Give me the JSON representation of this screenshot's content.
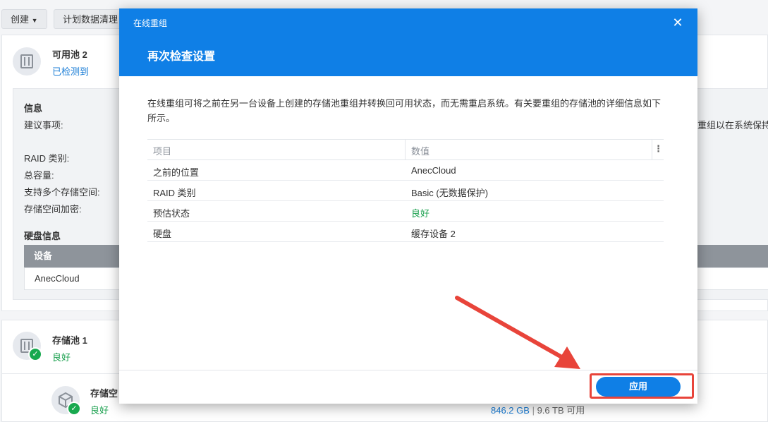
{
  "toolbar": {
    "create_label": "创建",
    "schedule_label": "计划数据清理"
  },
  "pool2": {
    "name": "可用池 2",
    "status": "已检测到",
    "info_heading": "信息",
    "recommendation_label": "建议事项:",
    "recommendation_tail": "重组以在系统保持",
    "raid_label": "RAID 类别:",
    "capacity_label": "总容量:",
    "multi_volume_label": "支持多个存储空间:",
    "encryption_label": "存储空间加密:",
    "disk_heading": "硬盘信息",
    "disk_col_device": "设备",
    "disk_row_device": "AnecCloud"
  },
  "pool1": {
    "name": "存储池 1",
    "status": "良好",
    "volume_name_partial": "存储空",
    "volume_status": "良好",
    "volume_used": "846.2 GB",
    "volume_sep": "|",
    "volume_total": "9.6 TB 可用"
  },
  "dialog": {
    "app_title": "在线重组",
    "close_icon": "close-icon",
    "title": "再次检查设置",
    "description": "在线重组可将之前在另一台设备上创建的存储池重组并转换回可用状态，而无需重启系统。有关要重组的存储池的详细信息如下所示。",
    "table": {
      "headers": [
        "项目",
        "数值"
      ],
      "menu_glyph": "⋮",
      "rows": [
        {
          "item": "之前的位置",
          "value": "AnecCloud",
          "status": "normal"
        },
        {
          "item": "RAID 类别",
          "value": "Basic (无数据保护)",
          "status": "normal"
        },
        {
          "item": "预估状态",
          "value": "良好",
          "status": "good"
        },
        {
          "item": "硬盘",
          "value": "缓存设备 2",
          "status": "normal"
        }
      ]
    },
    "apply_label": "应用"
  },
  "colors": {
    "accent": "#0f7fe6",
    "good": "#1aa04e",
    "annotation_red": "#e8443a"
  }
}
